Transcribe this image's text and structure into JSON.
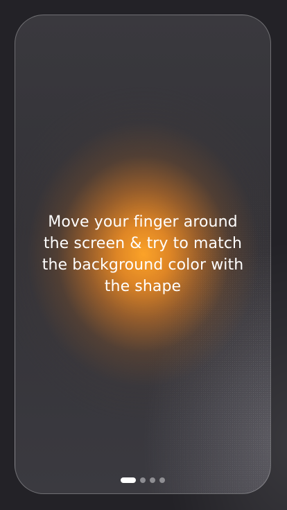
{
  "onboarding": {
    "message": "Move your finger around\nthe screen & try to match\nthe background color with\nthe shape",
    "shape_color": "#FCA328",
    "background_color": "#3A393E"
  },
  "pager": {
    "total_pages": 4,
    "current_page": 1
  }
}
